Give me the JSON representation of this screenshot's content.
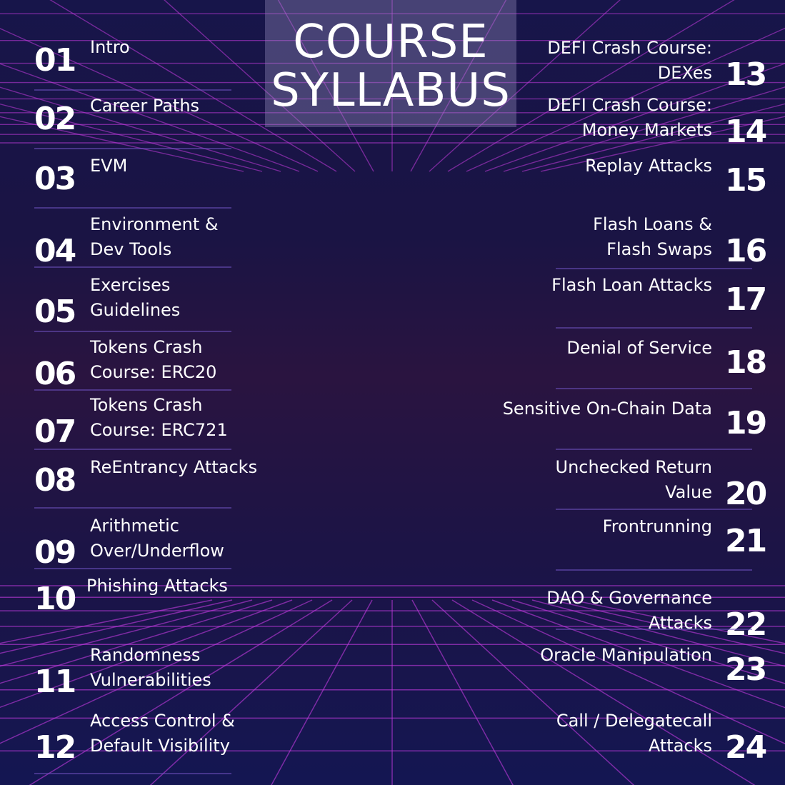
{
  "title": {
    "line1": "COURSE",
    "line2": "SYLLABUS"
  },
  "left_items": [
    {
      "number": "01",
      "label": "Intro"
    },
    {
      "number": "02",
      "label": "Career Paths"
    },
    {
      "number": "03",
      "label": "EVM"
    },
    {
      "number": "04",
      "label": "Environment &\nDev Tools"
    },
    {
      "number": "05",
      "label": "Exercises\nGuidelines"
    },
    {
      "number": "06",
      "label": "Tokens Crash\nCourse: ERC20"
    },
    {
      "number": "07",
      "label": "Tokens Crash\nCourse: ERC721"
    },
    {
      "number": "08",
      "label": "ReEntrancy Attacks"
    },
    {
      "number": "09",
      "label": "Arithmetic\nOver/Underflow"
    },
    {
      "number": "10",
      "label": "Phishing Attacks"
    },
    {
      "number": "11",
      "label": "Randomness\nVulnerabilities"
    },
    {
      "number": "12",
      "label": "Access Control &\nDefault Visibility"
    }
  ],
  "right_items": [
    {
      "number": "13",
      "label": "DEFI Crash Course:\nDEXes"
    },
    {
      "number": "14",
      "label": "DEFI Crash Course:\nMoney Markets"
    },
    {
      "number": "15",
      "label": "Replay Attacks"
    },
    {
      "number": "16",
      "label": "Flash Loans &\nFlash Swaps"
    },
    {
      "number": "17",
      "label": "Flash Loan Attacks"
    },
    {
      "number": "18",
      "label": "Denial of Service"
    },
    {
      "number": "19",
      "label": "Sensitive On-Chain Data"
    },
    {
      "number": "20",
      "label": "Unchecked Return\nValue"
    },
    {
      "number": "21",
      "label": "Frontrunning"
    },
    {
      "number": "22",
      "label": "DAO & Governance\nAttacks"
    },
    {
      "number": "23",
      "label": "Oracle Manipulation"
    },
    {
      "number": "24",
      "label": "Call / Delegatecall\nAttacks"
    }
  ],
  "colors": {
    "background": "#1a1446",
    "grid_line": "#c23adf",
    "text": "#ffffff"
  }
}
